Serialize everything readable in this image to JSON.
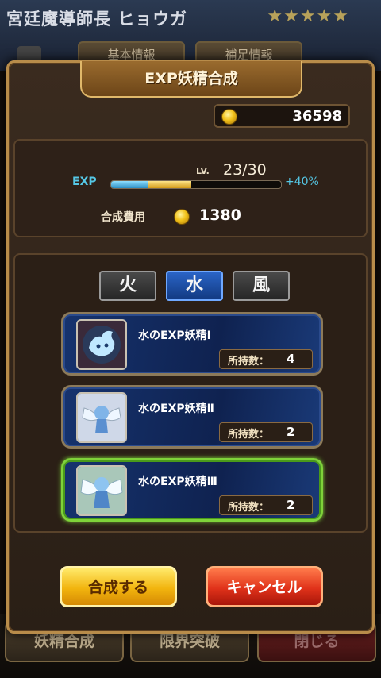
{
  "background": {
    "screen_title": "宮廷魔導師長 ヒョウガ",
    "stars": "★★★★★",
    "tabs": [
      "基本情報",
      "補足情報"
    ],
    "bottom_buttons": [
      "妖精合成",
      "限界突破",
      "閉じる"
    ]
  },
  "dialog": {
    "title": "EXP妖精合成",
    "gold": "36598",
    "exp_label": "EXP",
    "lv_label": "LV.",
    "lv_value": "23/30",
    "exp_bonus": "+40%",
    "exp_progress": {
      "current": 0.22,
      "preview": 0.47
    },
    "cost_label": "合成費用",
    "cost_value": "1380"
  },
  "element_tabs": [
    {
      "label": "火",
      "active": false
    },
    {
      "label": "水",
      "active": true
    },
    {
      "label": "風",
      "active": false
    }
  ],
  "fairies": [
    {
      "name": "水のEXP妖精Ⅰ",
      "count_label": "所持数：",
      "count": "4",
      "selected": false
    },
    {
      "name": "水のEXP妖精Ⅱ",
      "count_label": "所持数：",
      "count": "2",
      "selected": false
    },
    {
      "name": "水のEXP妖精Ⅲ",
      "count_label": "所持数：",
      "count": "2",
      "selected": true
    }
  ],
  "buttons": {
    "confirm": "合成する",
    "cancel": "キャンセル"
  },
  "colors": {
    "accent_gold": "#f2b40e",
    "cancel_red": "#e0321a",
    "selected_border": "#7fd23a",
    "exp_text": "#55c8e6"
  }
}
